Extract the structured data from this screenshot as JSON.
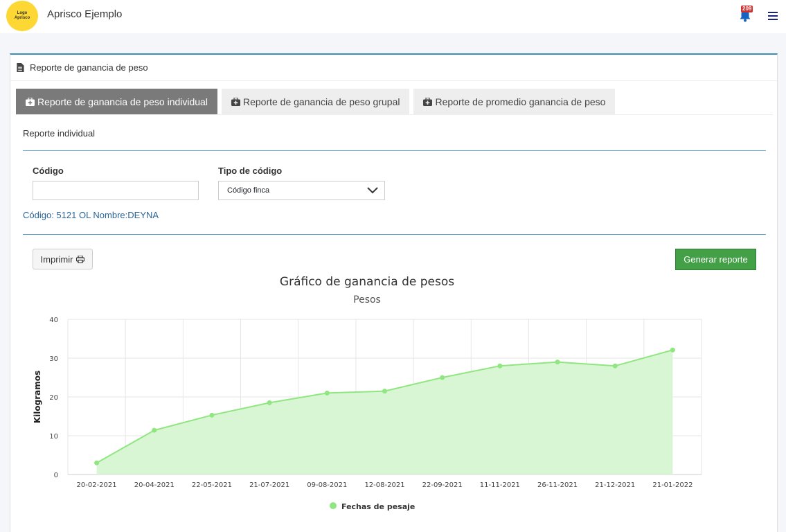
{
  "app": {
    "logo_lines": [
      "Logo",
      "Aprisco"
    ],
    "title": "Aprisco Ejemplo",
    "notification_count": "209"
  },
  "card": {
    "header": "Reporte de ganancia de peso"
  },
  "tabs": [
    {
      "label": "Reporte de ganancia de peso individual",
      "active": true
    },
    {
      "label": "Reporte de ganancia de peso grupal",
      "active": false
    },
    {
      "label": "Reporte de promedio ganancia de peso",
      "active": false
    }
  ],
  "form": {
    "section_title": "Reporte individual",
    "code_label": "Código",
    "code_value": "",
    "type_label": "Tipo de código",
    "type_selected": "Código finca",
    "info": "Código: 5121 OL Nombre:DEYNA"
  },
  "actions": {
    "print_label": "Imprimir",
    "generate_label": "Generar reporte"
  },
  "colors": {
    "accent": "#3c8dbc",
    "series": "#90e680",
    "series_fill": "#d8f6d3",
    "generate": "#43a047",
    "active_tab": "#7a7a7a"
  },
  "chart_data": {
    "type": "area",
    "title": "Gráfico de ganancia de pesos",
    "subtitle": "Pesos",
    "xlabel": "",
    "ylabel": "Kilogramos",
    "ylim": [
      0,
      40
    ],
    "yticks": [
      0,
      10,
      20,
      30,
      40
    ],
    "grid": true,
    "legend_position": "bottom",
    "categories": [
      "20-02-2021",
      "20-04-2021",
      "22-05-2021",
      "21-07-2021",
      "09-08-2021",
      "12-08-2021",
      "22-09-2021",
      "11-11-2021",
      "26-11-2021",
      "21-12-2021",
      "21-01-2022"
    ],
    "series": [
      {
        "name": "Fechas de pesaje",
        "values": [
          3,
          11.4,
          15.3,
          18.5,
          21,
          21.5,
          25,
          28,
          29,
          28,
          32.1
        ]
      }
    ]
  }
}
